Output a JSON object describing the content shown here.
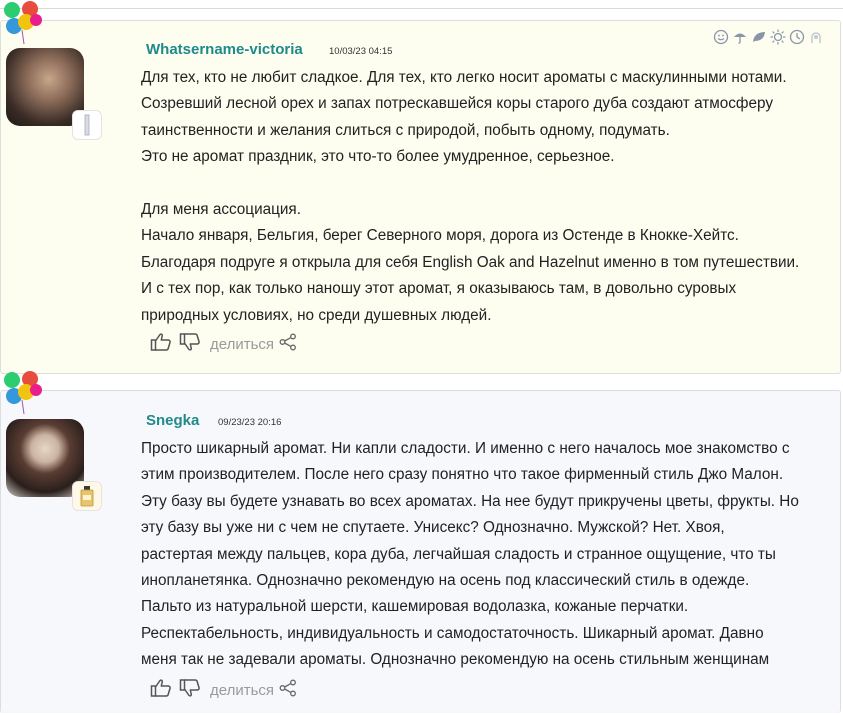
{
  "reviews": [
    {
      "author": "Whatsername-victoria",
      "date": "10/03/23 04:15",
      "lines": [
        "Для тех, кто не любит сладкое. Для тех, кто легко носит ароматы с маскулинными нотами.",
        "Созревший лесной орех и запах потрескавшейся коры старого дуба создают атмосферу",
        "таинственности и желания слиться с природой, побыть одному, подумать.",
        "Это не аромат праздник, это что-то более умудренное, серьезное.",
        "",
        "Для меня ассоциация.",
        "Начало января, Бельгия, берег Северного моря, дорога из Остенде в Кнокке-Хейтс.",
        "Благодаря подруге я открыла для себя English Oak and Hazelnut именно в том путешествии.",
        "И с тех пор, как только наношу этот аромат, я оказываюсь там, в довольно суровых",
        "природных условиях, но среди душевных людей."
      ],
      "share_label": "делиться"
    },
    {
      "author": "Snegka",
      "date": "09/23/23 20:16",
      "lines": [
        "Просто шикарный аромат. Ни капли сладости. И именно с него началось мое знакомство с",
        "этим производителем. После него сразу понятно что такое фирменный стиль Джо Малон.",
        "Эту базу вы будете узнавать во всех ароматах. На нее будут прикручены цветы, фрукты. Но",
        "эту базу вы уже ни с чем не спутаете. Унисекс? Однозначно. Мужской? Нет. Хвоя,",
        "растертая между пальцев, кора дуба, легчайшая сладость и странное ощущение, что ты",
        "инопланетянка. Однозначно рекомендую на осень под классический стиль в одежде.",
        "Пальто из натуральной шерсти, кашемировая водолазка, кожаные перчатки.",
        "Респектабельность, индивидуальность и самодостаточность. Шикарный аромат. Давно",
        "меня так не задевали ароматы. Однозначно рекомендую на осень стильным женщинам"
      ],
      "share_label": "делиться"
    }
  ],
  "icons": {
    "like": "thumbs-up-icon",
    "dislike": "thumbs-down-icon",
    "share": "share-icon",
    "mood": [
      "smile-icon",
      "umbrella-icon",
      "leaf-icon",
      "sun-icon",
      "clock-icon",
      "night-icon"
    ]
  },
  "colors": {
    "author": "#1f8a8a",
    "review_bg_1": "#fdfdf0",
    "review_bg_2": "#f7f8fb",
    "muted": "#9a9a9a"
  }
}
